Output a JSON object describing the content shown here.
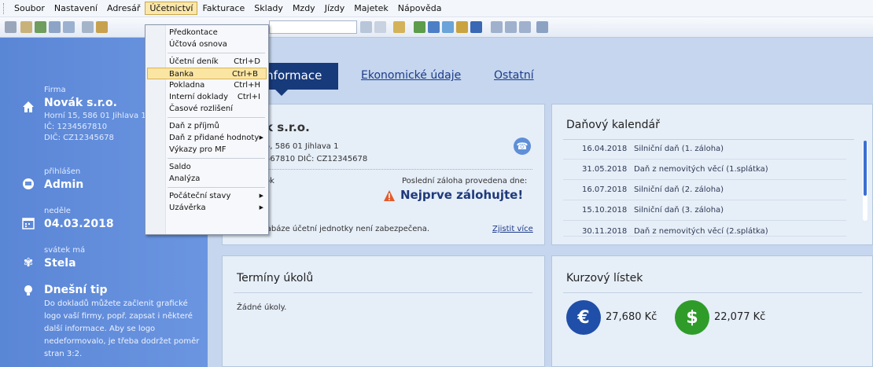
{
  "menubar": {
    "items": [
      "Soubor",
      "Nastavení",
      "Adresář",
      "Účetnictví",
      "Fakturace",
      "Sklady",
      "Mzdy",
      "Jízdy",
      "Majetek",
      "Nápověda"
    ]
  },
  "sidebar": {
    "firm_label": "Firma",
    "firm_name": "Novák s.r.o.",
    "firm_address": "Horní 15, 586 01 Jihlava 1",
    "firm_ic": "IČ: 1234567810",
    "firm_dic": "DIČ: CZ12345678",
    "user_label": "přihlášen",
    "user_name": "Admin",
    "day_label": "neděle",
    "date": "04.03.2018",
    "nameday_label": "svátek má",
    "nameday": "Stela",
    "tip_title": "Dnešní tip",
    "tip_text": "Do dokladů můžete začlenit grafické logo vaší firmy, popř. zapsat i některé další informace. Aby se logo nedeformovalo, je třeba dodržet poměr stran 3:2."
  },
  "tabs": {
    "active": "informace",
    "economic": "Ekonomické údaje",
    "other": "Ostatní"
  },
  "firm_panel": {
    "title": "k s.r.o.",
    "address": "5, 586 01 Jihlava 1",
    "ids": "567810  DIČ: CZ12345678",
    "left_text": "ok",
    "last_payment_label": "Poslední záloha provedena dne:",
    "warning": "Nejprve zálohujte!",
    "db_warning": "Databáze účetní jednotky není zabezpečena.",
    "learn_more": "Zjistit více"
  },
  "calendar": {
    "title": "Daňový kalendář",
    "rows": [
      {
        "date": "16.04.2018",
        "text": "Silniční daň (1. záloha)"
      },
      {
        "date": "31.05.2018",
        "text": "Daň z nemovitých věcí (1.splátka)"
      },
      {
        "date": "16.07.2018",
        "text": "Silniční daň (2. záloha)"
      },
      {
        "date": "15.10.2018",
        "text": "Silniční daň (3. záloha)"
      },
      {
        "date": "30.11.2018",
        "text": "Daň z nemovitých věcí (2.splátka)"
      }
    ]
  },
  "tasks": {
    "title": "Termíny úkolů",
    "empty": "Žádné úkoly."
  },
  "rates": {
    "title": "Kurzový lístek",
    "eur": "27,680 Kč",
    "usd": "22,077 Kč",
    "eur_symbol": "€",
    "usd_symbol": "$"
  },
  "dropdown": {
    "items": [
      {
        "label": "Předkontace",
        "shortcut": ""
      },
      {
        "label": "Účtová osnova",
        "shortcut": ""
      },
      {
        "label": "Účetní deník",
        "shortcut": "Ctrl+D"
      },
      {
        "label": "Banka",
        "shortcut": "Ctrl+B"
      },
      {
        "label": "Pokladna",
        "shortcut": "Ctrl+H"
      },
      {
        "label": "Interní doklady",
        "shortcut": "Ctrl+I"
      },
      {
        "label": "Časové rozlišení",
        "shortcut": ""
      },
      {
        "label": "Daň z příjmů",
        "shortcut": ""
      },
      {
        "label": "Daň z přidané hodnoty",
        "shortcut": ""
      },
      {
        "label": "Výkazy pro MF",
        "shortcut": ""
      },
      {
        "label": "Saldo",
        "shortcut": ""
      },
      {
        "label": "Analýza",
        "shortcut": ""
      },
      {
        "label": "Počáteční stavy",
        "shortcut": ""
      },
      {
        "label": "Uzávěrka",
        "shortcut": ""
      }
    ]
  },
  "colors": {
    "sidebar": "#5a86d6",
    "active_tab": "#173a7b",
    "highlight": "#fbe5a3",
    "eur_coin": "#1f4fa8",
    "usd_coin": "#2f9c2a"
  }
}
